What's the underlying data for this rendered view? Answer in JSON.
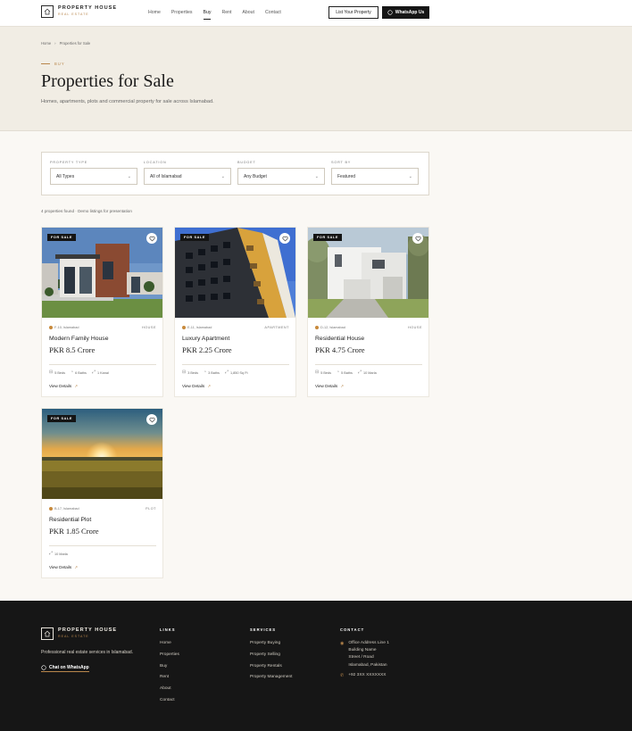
{
  "brand": {
    "name": "PROPERTY HOUSE",
    "tagline": "REAL ESTATE"
  },
  "nav": [
    {
      "label": "Home"
    },
    {
      "label": "Properties"
    },
    {
      "label": "Buy"
    },
    {
      "label": "Rent"
    },
    {
      "label": "About"
    },
    {
      "label": "Contact"
    }
  ],
  "header": {
    "list_button": "List Your Property",
    "whatsapp_button": "WhatsApp Us"
  },
  "hero": {
    "breadcrumb": [
      "Home",
      "›",
      "Properties for Sale"
    ],
    "eyebrow": "BUY",
    "title": "Properties for Sale",
    "description": "Homes, apartments, plots and commercial property for sale across Islamabad."
  },
  "filters": [
    {
      "label": "PROPERTY TYPE",
      "value": "All Types"
    },
    {
      "label": "LOCATION",
      "value": "All of Islamabad"
    },
    {
      "label": "BUDGET",
      "value": "Any Budget"
    },
    {
      "label": "SORT BY",
      "value": "Featured"
    }
  ],
  "results_text": "4 properties found · Demo listings for presentation",
  "listings": [
    {
      "badge": "FOR SALE",
      "location": "F-10, Islamabad",
      "type": "HOUSE",
      "title": "Modern Family House",
      "price": "PKR 8.5 Crore",
      "features": [
        {
          "icon": "bed-icon",
          "text": "5 Beds"
        },
        {
          "icon": "bath-icon",
          "text": "6 Baths"
        },
        {
          "icon": "area-icon",
          "text": "1 Kanal"
        }
      ],
      "cta": "View Details"
    },
    {
      "badge": "FOR SALE",
      "location": "E-11, Islamabad",
      "type": "APARTMENT",
      "title": "Luxury Apartment",
      "price": "PKR 2.25 Crore",
      "features": [
        {
          "icon": "bed-icon",
          "text": "3 Beds"
        },
        {
          "icon": "bath-icon",
          "text": "3 Baths"
        },
        {
          "icon": "area-icon",
          "text": "1,850 Sq Ft"
        }
      ],
      "cta": "View Details"
    },
    {
      "badge": "FOR SALE",
      "location": "D-12, Islamabad",
      "type": "HOUSE",
      "title": "Residential House",
      "price": "PKR 4.75 Crore",
      "features": [
        {
          "icon": "bed-icon",
          "text": "5 Beds"
        },
        {
          "icon": "bath-icon",
          "text": "5 Baths"
        },
        {
          "icon": "area-icon",
          "text": "10 Marla"
        }
      ],
      "cta": "View Details"
    },
    {
      "badge": "FOR SALE",
      "location": "B-17, Islamabad",
      "type": "PLOT",
      "title": "Residential Plot",
      "price": "PKR 1.85 Crore",
      "features": [
        {
          "icon": "area-icon",
          "text": "10 Marla"
        }
      ],
      "cta": "View Details"
    }
  ],
  "footer": {
    "tagline": "Professional real estate services in Islamabad.",
    "whatsapp": "Chat on WhatsApp",
    "links_title": "LINKS",
    "links": [
      "Home",
      "Properties",
      "Buy",
      "Rent",
      "About",
      "Contact"
    ],
    "services_title": "SERVICES",
    "services": [
      "Property Buying",
      "Property Selling",
      "Property Rentals",
      "Property Management"
    ],
    "contact_title": "CONTACT",
    "address": [
      "Office Address Line 1",
      "Building Name",
      "Street / Road",
      "Islamabad, Pakistan"
    ],
    "phone": "+92 3XX XXXXXXX"
  },
  "colors": {
    "accent": "#b8864b",
    "dark": "#161616",
    "hero_bg": "#f1ede4",
    "page_bg": "#faf8f4"
  }
}
